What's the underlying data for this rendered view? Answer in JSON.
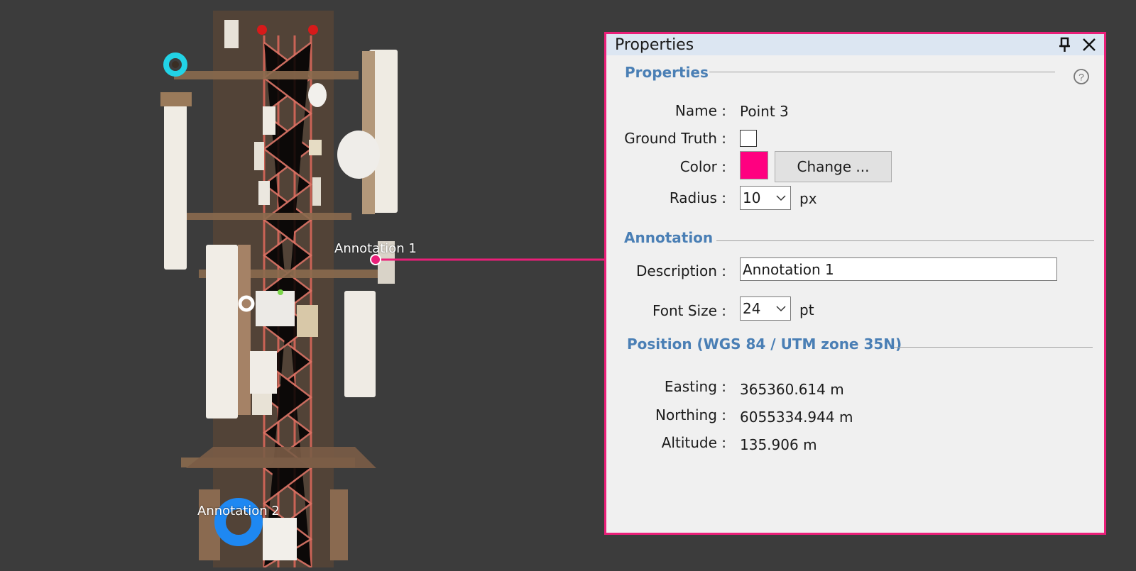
{
  "scene": {
    "annotation1_label": "Annotation 1",
    "annotation2_label": "Annotation 2",
    "colors": {
      "background": "#3c3c3c",
      "leader_line": "#ea1f79",
      "point_cyan": "#22d3e6",
      "point_blue": "#1e88f2",
      "point_white": "#ffffff",
      "point_magenta": "#ea1f79"
    }
  },
  "panel": {
    "title": "Properties",
    "pin_icon": "pin-icon",
    "close_icon": "close-icon",
    "help_icon": "help-icon",
    "border_color": "#ea1f79",
    "titlebar_color": "#dce6f2"
  },
  "properties": {
    "header": "Properties",
    "name_label": "Name :",
    "name_value": "Point 3",
    "ground_truth_label": "Ground Truth :",
    "ground_truth_checked": false,
    "color_label": "Color :",
    "color_value": "#ff0080",
    "change_button": "Change ...",
    "radius_label": "Radius :",
    "radius_value": "10",
    "radius_unit": "px"
  },
  "annotation": {
    "header": "Annotation",
    "description_label": "Description :",
    "description_value": "Annotation 1",
    "font_size_label": "Font Size :",
    "font_size_value": "24",
    "font_size_unit": "pt"
  },
  "position": {
    "header": "Position (WGS 84 / UTM zone 35N)",
    "easting_label": "Easting :",
    "easting_value": "365360.614 m",
    "northing_label": "Northing :",
    "northing_value": "6055334.944 m",
    "altitude_label": "Altitude :",
    "altitude_value": "135.906 m"
  }
}
